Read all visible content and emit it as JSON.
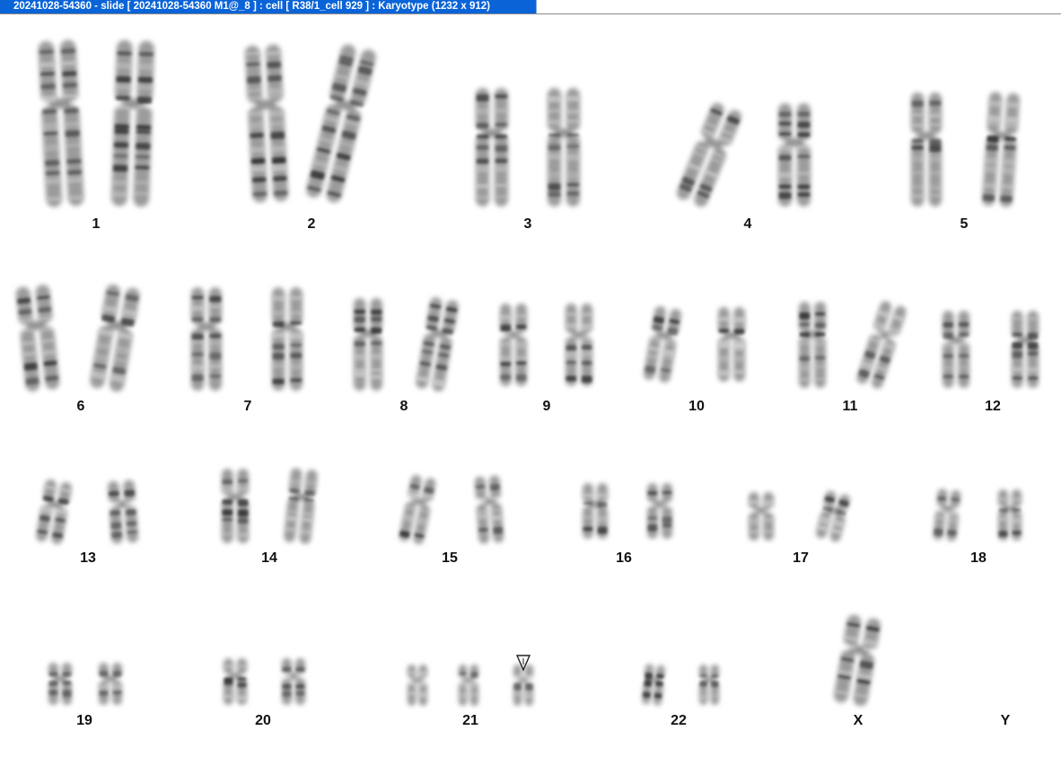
{
  "window": {
    "title": "20241028-54360 - slide [ 20241028-54360 M1@_8 ] : cell [ R38/1_cell 929 ] : Karyotype  (1232 x 912)"
  },
  "karyotype": {
    "pairs": [
      {
        "label": "1",
        "count": 2
      },
      {
        "label": "2",
        "count": 2
      },
      {
        "label": "3",
        "count": 2
      },
      {
        "label": "4",
        "count": 2
      },
      {
        "label": "5",
        "count": 2
      },
      {
        "label": "6",
        "count": 2
      },
      {
        "label": "7",
        "count": 2
      },
      {
        "label": "8",
        "count": 2
      },
      {
        "label": "9",
        "count": 2
      },
      {
        "label": "10",
        "count": 2
      },
      {
        "label": "11",
        "count": 2
      },
      {
        "label": "12",
        "count": 2
      },
      {
        "label": "13",
        "count": 2
      },
      {
        "label": "14",
        "count": 2
      },
      {
        "label": "15",
        "count": 2
      },
      {
        "label": "16",
        "count": 2
      },
      {
        "label": "17",
        "count": 2
      },
      {
        "label": "18",
        "count": 2
      },
      {
        "label": "19",
        "count": 2
      },
      {
        "label": "20",
        "count": 2
      },
      {
        "label": "21",
        "count": 3,
        "marked": true
      },
      {
        "label": "22",
        "count": 2
      },
      {
        "label": "X",
        "count": 1
      },
      {
        "label": "Y",
        "count": 0
      }
    ]
  }
}
